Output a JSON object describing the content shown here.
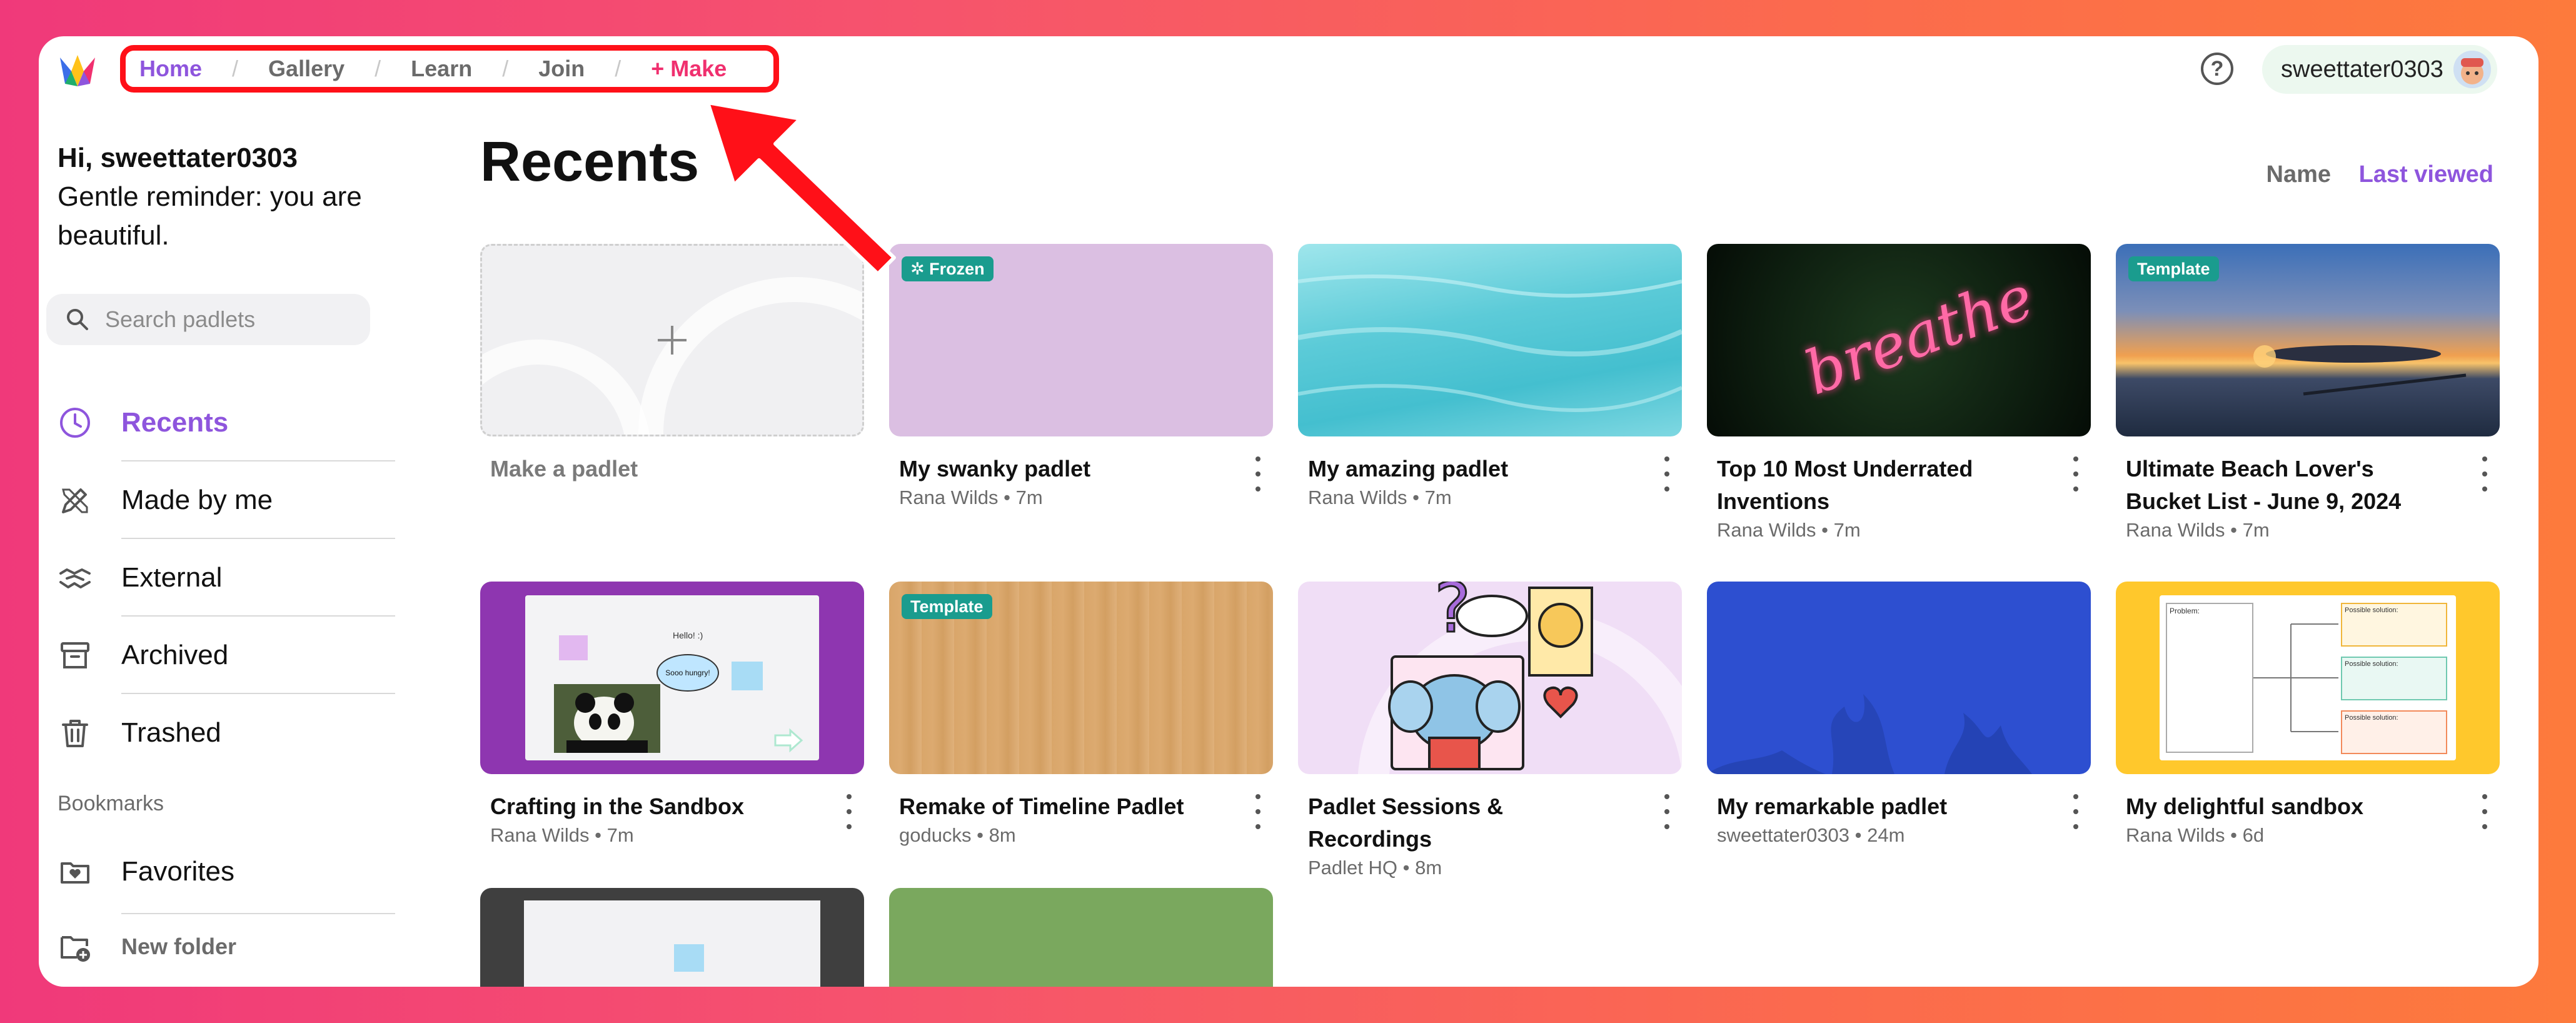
{
  "nav": {
    "home": "Home",
    "gallery": "Gallery",
    "learn": "Learn",
    "join": "Join",
    "make": "+ Make",
    "separator": "/"
  },
  "header": {
    "help": "?",
    "username": "sweettater0303"
  },
  "sidebar": {
    "greeting_name": "Hi, sweettater0303",
    "greeting_message": "Gentle reminder: you are beautiful.",
    "search_placeholder": "Search padlets",
    "items": [
      {
        "label": "Recents",
        "icon": "clock-icon"
      },
      {
        "label": "Made by me",
        "icon": "pencil-ruler-icon"
      },
      {
        "label": "External",
        "icon": "handshake-icon"
      },
      {
        "label": "Archived",
        "icon": "archive-box-icon"
      },
      {
        "label": "Trashed",
        "icon": "trash-icon"
      }
    ],
    "bookmarks_label": "Bookmarks",
    "bookmarks": [
      {
        "label": "Favorites",
        "icon": "heart-folder-icon"
      },
      {
        "label": "New folder",
        "icon": "add-folder-icon"
      }
    ]
  },
  "main": {
    "title": "Recents",
    "sort_name": "Name",
    "sort_last_viewed": "Last viewed",
    "make_label": "Make a padlet",
    "cards": [
      {
        "title": "My swanky padlet",
        "author": "Rana Wilds",
        "time": "7m",
        "badge": "✲ Frozen"
      },
      {
        "title": "My amazing padlet",
        "author": "Rana Wilds",
        "time": "7m",
        "badge": ""
      },
      {
        "title": "Top 10 Most Underrated Inventions",
        "author": "Rana Wilds",
        "time": "7m",
        "badge": "",
        "art_text": "breathe"
      },
      {
        "title": "Ultimate Beach Lover's Bucket List - June 9, 2024",
        "author": "Rana Wilds",
        "time": "7m",
        "badge": "Template"
      },
      {
        "title": "Crafting in the Sandbox",
        "author": "Rana Wilds",
        "time": "7m",
        "badge": "",
        "art_text": [
          "Hello! :)",
          "Sooo hungry!"
        ]
      },
      {
        "title": "Remake of Timeline Padlet",
        "author": "goducks",
        "time": "8m",
        "badge": "Template"
      },
      {
        "title": "Padlet Sessions & Recordings",
        "author": "Padlet HQ",
        "time": "8m",
        "badge": ""
      },
      {
        "title": "My remarkable padlet",
        "author": "sweettater0303",
        "time": "24m",
        "badge": ""
      },
      {
        "title": "My delightful sandbox",
        "author": "Rana Wilds",
        "time": "6d",
        "badge": "",
        "art_text": [
          "Problem:",
          "Possible solution:"
        ]
      }
    ],
    "meta_separator": "•"
  },
  "colors": {
    "accent_purple": "#8e55dd",
    "make_pink": "#f0306f",
    "highlight_red": "#ff1018",
    "badge_teal": "#1a9c8e"
  }
}
